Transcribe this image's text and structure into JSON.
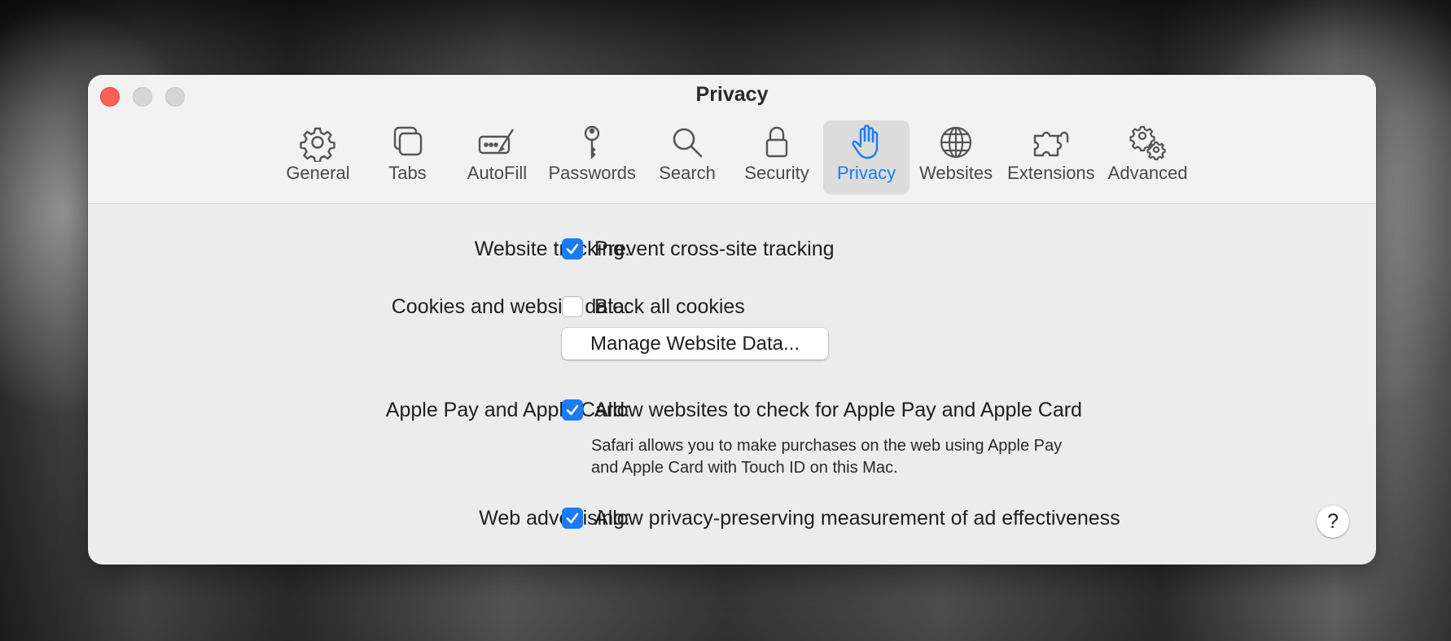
{
  "window": {
    "title": "Privacy",
    "traffic_lights": [
      "close",
      "minimize",
      "zoom"
    ]
  },
  "toolbar": {
    "selected": "Privacy",
    "items": [
      {
        "label": "General",
        "icon": "gear-icon"
      },
      {
        "label": "Tabs",
        "icon": "tabs-icon"
      },
      {
        "label": "AutoFill",
        "icon": "autofill-icon"
      },
      {
        "label": "Passwords",
        "icon": "key-icon"
      },
      {
        "label": "Search",
        "icon": "search-icon"
      },
      {
        "label": "Security",
        "icon": "lock-icon"
      },
      {
        "label": "Privacy",
        "icon": "hand-icon"
      },
      {
        "label": "Websites",
        "icon": "globe-icon"
      },
      {
        "label": "Extensions",
        "icon": "puzzle-icon"
      },
      {
        "label": "Advanced",
        "icon": "gears-icon"
      }
    ]
  },
  "settings": {
    "tracking": {
      "label": "Website tracking:",
      "option": "Prevent cross-site tracking",
      "checked": true
    },
    "cookies": {
      "label": "Cookies and website data:",
      "option": "Block all cookies",
      "checked": false,
      "button": "Manage Website Data..."
    },
    "applepay": {
      "label": "Apple Pay and Apple Card:",
      "option": "Allow websites to check for Apple Pay and Apple Card",
      "checked": true,
      "note_line1": "Safari allows you to make purchases on the web using Apple Pay",
      "note_line2": "and Apple Card with Touch ID on this Mac."
    },
    "advertising": {
      "label": "Web advertising:",
      "option": "Allow privacy-preserving measurement of ad effectiveness",
      "checked": true
    }
  },
  "help": {
    "label": "?"
  },
  "colors": {
    "accent": "#1a7cf5",
    "close": "#ff5f57",
    "window_bg": "#ececec"
  }
}
